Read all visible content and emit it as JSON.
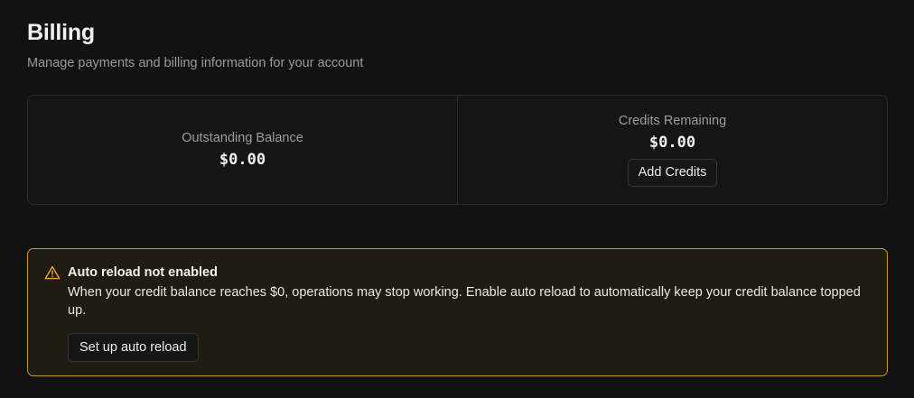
{
  "header": {
    "title": "Billing",
    "subtitle": "Manage payments and billing information for your account"
  },
  "balances": {
    "outstanding": {
      "label": "Outstanding Balance",
      "value": "$0.00"
    },
    "credits": {
      "label": "Credits Remaining",
      "value": "$0.00",
      "button_label": "Add Credits"
    }
  },
  "alert": {
    "icon": "warning-triangle-icon",
    "title": "Auto reload not enabled",
    "body": "When your credit balance reaches $0, operations may stop working. Enable auto reload to automatically keep your credit balance topped up.",
    "button_label": "Set up auto reload",
    "accent_color": "#c8962c"
  }
}
